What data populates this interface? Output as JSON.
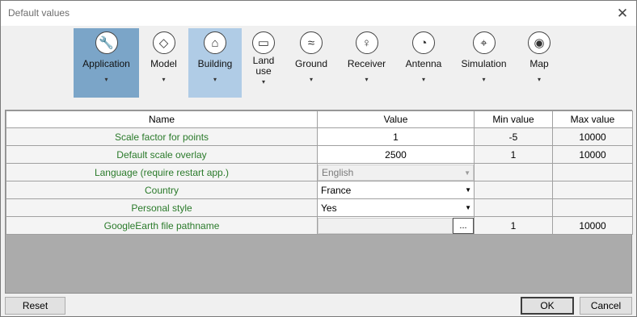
{
  "window": {
    "title": "Default values",
    "close_glyph": "✕"
  },
  "toolbar": {
    "items": [
      {
        "label": "Application",
        "icon": "wrench-icon",
        "glyph": "🔧",
        "arrow": "▾"
      },
      {
        "label": "Model",
        "icon": "mesh-icon",
        "glyph": "◇",
        "arrow": "▾"
      },
      {
        "label": "Building",
        "icon": "house-icon",
        "glyph": "⌂",
        "arrow": "▾"
      },
      {
        "label": "Land\nuse",
        "icon": "land-use-icon",
        "glyph": "▭",
        "arrow": "▾"
      },
      {
        "label": "Ground",
        "icon": "terrain-icon",
        "glyph": "≈",
        "arrow": "▾"
      },
      {
        "label": "Receiver",
        "icon": "receiver-icon",
        "glyph": "♀",
        "arrow": "▾"
      },
      {
        "label": "Antenna",
        "icon": "antenna-icon",
        "glyph": "◔",
        "arrow": "▾"
      },
      {
        "label": "Simulation",
        "icon": "simulation-icon",
        "glyph": "⌖",
        "arrow": "▾"
      },
      {
        "label": "Map",
        "icon": "map-icon",
        "glyph": "◉",
        "arrow": "▾"
      }
    ]
  },
  "grid": {
    "columns": [
      "Name",
      "Value",
      "Min value",
      "Max value"
    ],
    "rows": [
      {
        "name": "Scale factor for points",
        "value": "1",
        "min": "-5",
        "max": "10000"
      },
      {
        "name": "Default scale overlay",
        "value": "2500",
        "min": "1",
        "max": "10000"
      },
      {
        "name": "Language (require restart app.)",
        "value": "English",
        "min": "",
        "max": ""
      },
      {
        "name": "Country",
        "value": "France",
        "min": "",
        "max": ""
      },
      {
        "name": "Personal style",
        "value": "Yes",
        "min": "",
        "max": ""
      },
      {
        "name": "GoogleEarth file pathname",
        "value": "",
        "min": "1",
        "max": "10000"
      }
    ],
    "browse_label": "...",
    "dropdown_arrow": "▼"
  },
  "buttons": {
    "reset": "Reset",
    "ok": "OK",
    "cancel": "Cancel"
  },
  "colors": {
    "accent_active": "#7ba5c8",
    "accent_hover": "#b0cce6",
    "name_text": "#2a7a2a"
  }
}
